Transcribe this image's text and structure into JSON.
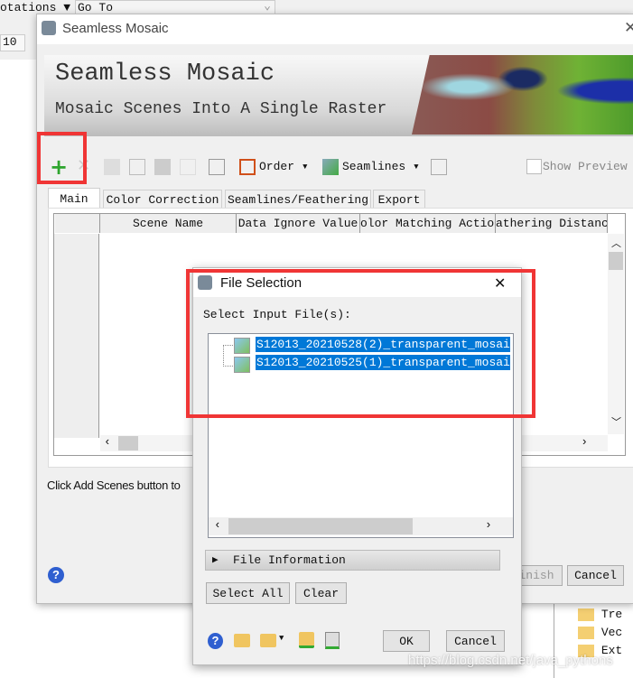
{
  "background": {
    "annotations_menu": "otations ▼",
    "goto_label": "Go To",
    "number_value": "10",
    "tree_items": [
      "Tre",
      "Vec",
      "Ext"
    ]
  },
  "mosaic": {
    "title": "Seamless Mosaic",
    "banner_title": "Seamless Mosaic",
    "banner_subtitle": "Mosaic Scenes Into A Single Raster",
    "toolbar": {
      "order": "Order",
      "seamlines": "Seamlines",
      "show_preview": "Show Preview"
    },
    "tabs": [
      "Main",
      "Color Correction",
      "Seamlines/Feathering",
      "Export"
    ],
    "columns": [
      "Scene Name",
      "Data Ignore Value",
      "olor Matching Actior",
      "athering Distanc"
    ],
    "hint": "Click Add Scenes button to",
    "finish": "inish",
    "cancel": "Cancel"
  },
  "file_dialog": {
    "title": "File Selection",
    "prompt": "Select Input File(s):",
    "files": [
      "S12013_20210528(2)_transparent_mosai",
      "S12013_20210525(1)_transparent_mosai"
    ],
    "file_information": "File Information",
    "select_all": "Select All",
    "clear": "Clear",
    "ok": "OK",
    "cancel": "Cancel"
  },
  "watermark": "https://blog.csdn.net/java_pythons",
  "colors": {
    "highlight": "#f03535",
    "selection": "#0078d7"
  }
}
